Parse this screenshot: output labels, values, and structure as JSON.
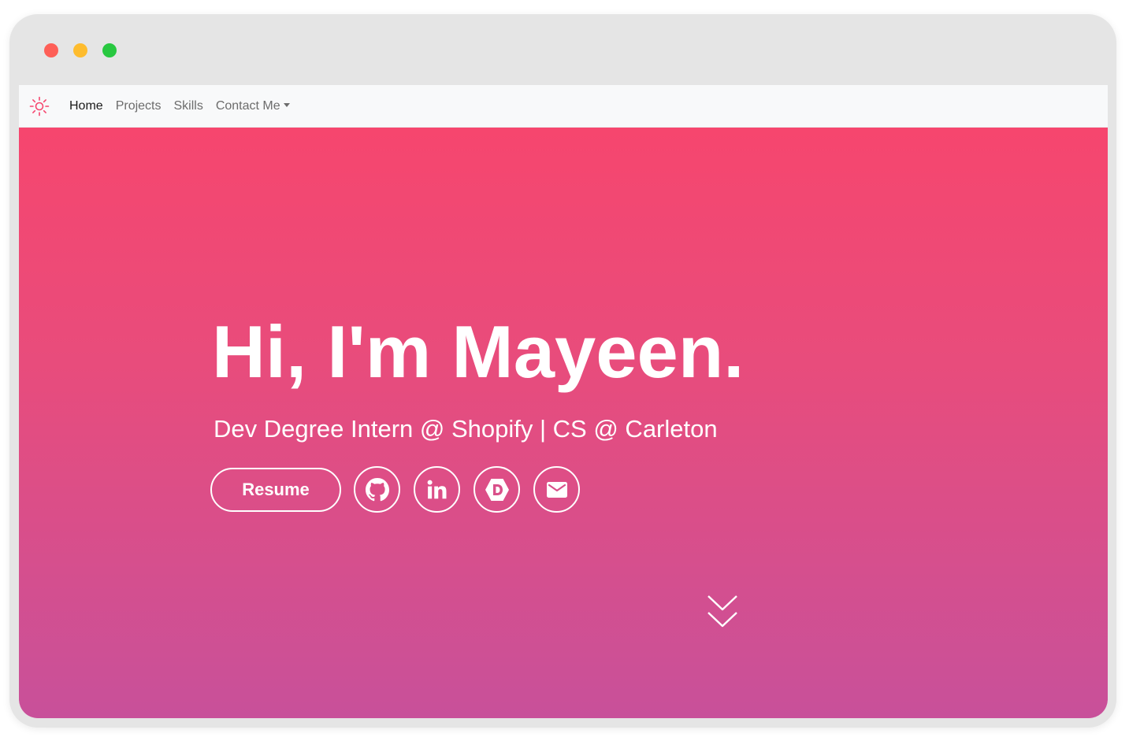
{
  "window": {
    "traffic_lights": {
      "close_color": "#fe5f57",
      "minimize_color": "#febc2e",
      "maximize_color": "#28c840"
    }
  },
  "navbar": {
    "logo_icon": "sun-icon",
    "accent_color": "#f6466e",
    "items": [
      {
        "label": "Home",
        "active": true
      },
      {
        "label": "Projects",
        "active": false
      },
      {
        "label": "Skills",
        "active": false
      },
      {
        "label": "Contact Me",
        "active": false,
        "dropdown": true
      }
    ]
  },
  "hero": {
    "title": "Hi, I'm Mayeen.",
    "subtitle": "Dev Degree Intern @ Shopify | CS @ Carleton",
    "resume_label": "Resume",
    "social_icons": [
      "github-icon",
      "linkedin-icon",
      "devpost-icon",
      "email-icon"
    ],
    "scroll_icon": "double-chevron-down-icon",
    "gradient_top": "#f6466e",
    "gradient_bottom": "#c8509a"
  }
}
